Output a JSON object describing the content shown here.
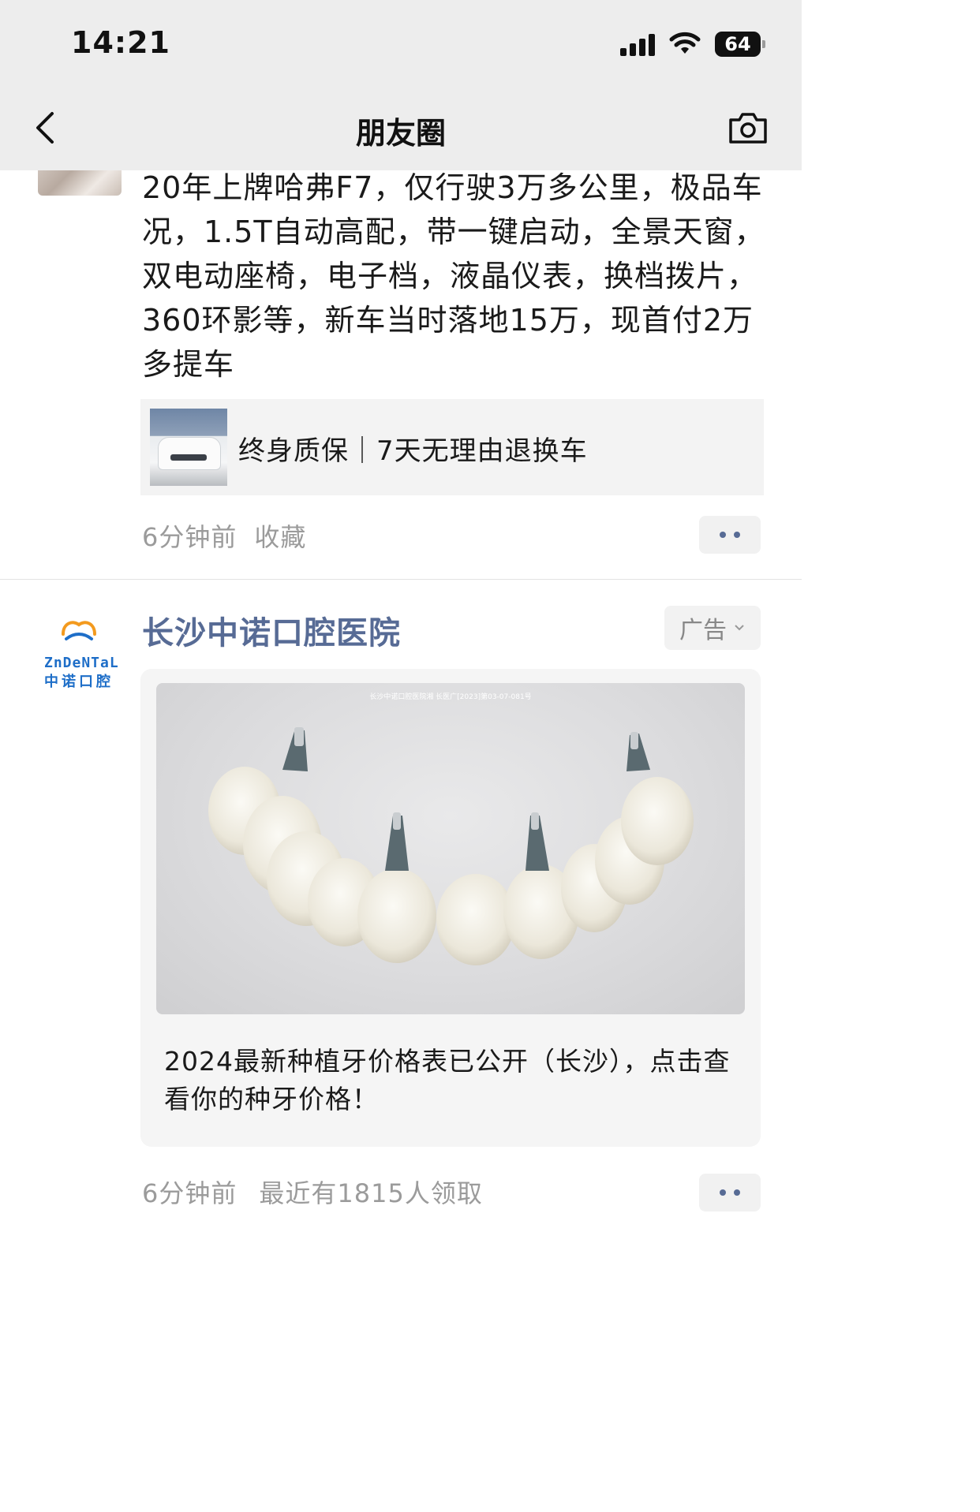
{
  "status_bar": {
    "time": "14:21",
    "battery": "64"
  },
  "nav": {
    "title": "朋友圈",
    "back_icon": "chevron-left-icon",
    "camera_icon": "camera-icon"
  },
  "post1": {
    "text": "20年上牌哈弗F7，仅行驶3万多公里，极品车况，1.5T自动高配，带一键启动，全景天窗，双电动座椅，电子档，液晶仪表，换档拨片，360环影等，新车当时落地15万，现首付2万多提车",
    "link_title": "终身质保｜7天无理由退换车",
    "time": "6分钟前",
    "action": "收藏"
  },
  "post2": {
    "author": "长沙中诺口腔医院",
    "ad_label": "广告",
    "logo_en": "ZnDeNTaL",
    "logo_cn": "中诺口腔",
    "image_caption": "长沙中诺口腔医院湘 长医广[2023]第03-07-081号",
    "ad_text": "2024最新种植牙价格表已公开（长沙），点击查看你的种牙价格！",
    "time": "6分钟前",
    "stats": "最近有1815人领取"
  },
  "colors": {
    "link_blue": "#576b95",
    "meta_gray": "#9b9b9b",
    "nav_bg": "#ededed",
    "logo_blue": "#1e6ec8"
  }
}
